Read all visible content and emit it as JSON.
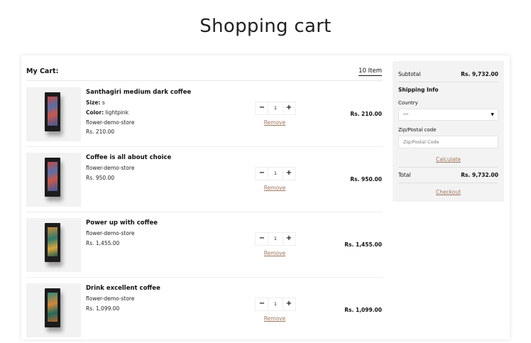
{
  "page": {
    "title": "Shopping cart"
  },
  "cart": {
    "label": "My Cart:",
    "item_count": "10 Item",
    "remove_label": "Remove",
    "items": [
      {
        "title": "Santhagiri medium dark coffee",
        "size_label": "Size:",
        "size": "s",
        "color_label": "Color:",
        "color": "lightpink",
        "vendor": "flower-demo-store",
        "unit_price": "Rs. 210.00",
        "qty": "1",
        "line_total": "Rs. 210.00"
      },
      {
        "title": "Coffee is all about choice",
        "vendor": "flower-demo-store",
        "unit_price": "Rs. 950.00",
        "qty": "1",
        "line_total": "Rs. 950.00"
      },
      {
        "title": "Power up with coffee",
        "vendor": "flower-demo-store",
        "unit_price": "Rs. 1,455.00",
        "qty": "1",
        "line_total": "Rs. 1,455.00"
      },
      {
        "title": "Drink excellent coffee",
        "vendor": "flower-demo-store",
        "unit_price": "Rs. 1,099.00",
        "qty": "1",
        "line_total": "Rs. 1,099.00"
      }
    ],
    "qty_minus": "−",
    "qty_plus": "+"
  },
  "summary": {
    "subtotal_label": "Subtotal",
    "subtotal_value": "Rs. 9,732.00",
    "shipping_heading": "Shipping Info",
    "country_label": "Country",
    "country_selected": "---",
    "zip_label": "Zip/Postal code",
    "zip_placeholder": "Zip/Postal Code",
    "calculate_label": "Calculate",
    "total_label": "Total",
    "total_value": "Rs. 9,732.00",
    "checkout_label": "Checkout"
  },
  "colors": {
    "accent_link": "#a0755c",
    "summary_bg": "#f3f3f3"
  },
  "icons": {
    "select_caret": "caret-down-icon"
  }
}
